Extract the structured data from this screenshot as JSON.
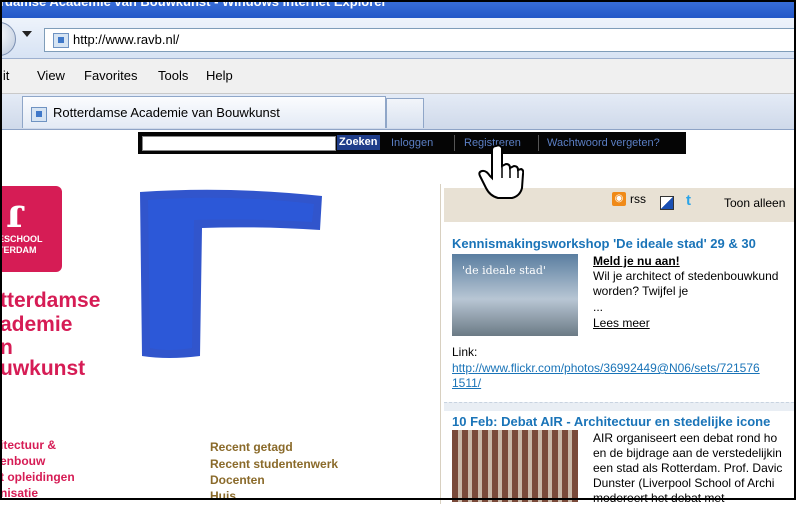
{
  "browser": {
    "title": "rdamse Academie van Bouwkunst - Windows Internet Explorer",
    "url": "http://www.ravb.nl/",
    "menu": [
      "lit",
      "View",
      "Favorites",
      "Tools",
      "Help"
    ],
    "tab_title": "Rotterdamse Academie van Bouwkunst"
  },
  "site": {
    "search_button": "Zoeken",
    "login": "Inloggen",
    "register": "Registreren",
    "forgot": "Wachtwoord vergeten?",
    "logo_line1": "ESCHOOL",
    "logo_line2": "TERDAM",
    "academy_lines": [
      "tterdamse",
      "ademie",
      "n",
      "uwkunst"
    ],
    "left_nav": [
      "itectuur &",
      "enbouw",
      "t opleidingen",
      "nisatie"
    ],
    "mid_nav": [
      "Recent getagd",
      "Recent studentenwerk",
      "Docenten",
      "Huis"
    ],
    "rss_label": "rss",
    "twitter_glyph": "t",
    "toon": "Toon alleen",
    "news1": {
      "title": "Kennismakingsworkshop 'De ideale stad' 29 & 30",
      "image_caption": "'de ideale stad'",
      "headline": "Meld je nu aan!",
      "text1": "Wil je architect of stedenbouwkund",
      "text2": "worden? Twijfel je",
      "ellipsis": "...",
      "more": "Lees meer",
      "link_label": "Link:",
      "link1": "http://www.flickr.com/photos/36992449@N06/sets/721576",
      "link2": "1511/"
    },
    "news2": {
      "title": "10 Feb: Debat AIR - Architectuur en stedelijke icone",
      "lines": [
        "AIR organiseert een debat rond ho",
        "en de bijdrage aan de verstedelijkin",
        "een stad als Rotterdam. Prof. Davic",
        "Dunster (Liverpool School of Archi",
        "modereert het debat met"
      ]
    }
  },
  "colors": {
    "accent": "#d61c55",
    "link": "#1a74b8",
    "nav_brown": "#8a6a2a",
    "logo_blue": "#1f46c8"
  }
}
